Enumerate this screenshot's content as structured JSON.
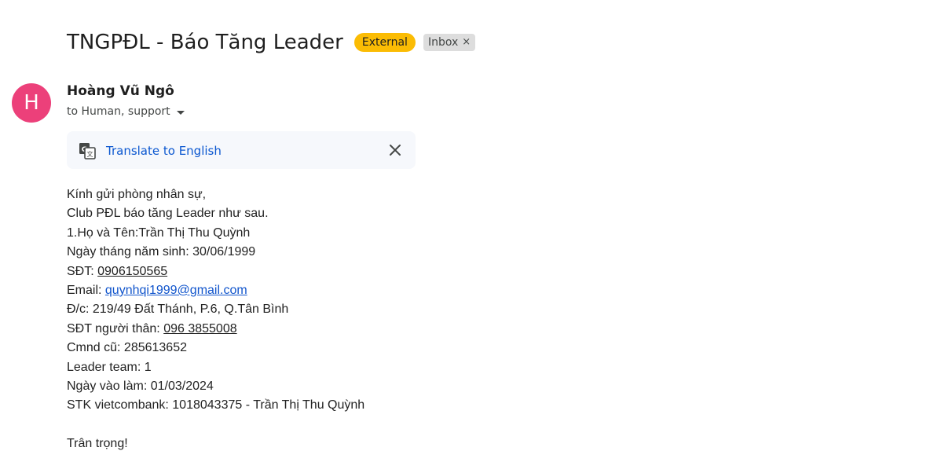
{
  "email": {
    "subject": "TNGPĐL - Báo Tăng Leader",
    "badges": {
      "external": "External",
      "inbox": "Inbox",
      "inbox_remove_glyph": "×"
    },
    "sender": {
      "avatar_letter": "H",
      "avatar_color": "#ec407a",
      "name": "Hoàng Vũ Ngô",
      "recipients": "to Human, support"
    },
    "translate": {
      "label": "Translate to English",
      "icon": "translate-icon",
      "close_icon": "close-icon"
    },
    "body": {
      "greeting": "Kính gửi phòng nhân sự,",
      "intro": "Club PĐL báo tăng Leader như sau.",
      "name_line": "1.Họ và Tên:Trần Thị Thu Quỳnh",
      "dob_line": "Ngày tháng năm sinh: 30/06/1999",
      "phone_label": "SĐT: ",
      "phone_value": "0906150565",
      "email_label": "Email: ",
      "email_value": "quynhqi1999@gmail.com",
      "address_line": "Đ/c: 219/49 Đất Thánh, P.6, Q.Tân Bình",
      "relative_phone_label": "SĐT người thân: ",
      "relative_phone_value": "096 3855008",
      "id_line": "Cmnd cũ: 285613652",
      "team_line": "Leader team: 1",
      "start_date_line": "Ngày vào làm: 01/03/2024",
      "bank_line": "STK vietcombank: 1018043375 - Trần Thị Thu Quỳnh",
      "closing": "Trân trọng!"
    }
  },
  "colors": {
    "external_badge": "#fbbc04",
    "inbox_badge": "#dddddd",
    "link_blue": "#0b57d0",
    "email_link": "#1155cc",
    "translate_bar_bg": "#f6f8fc"
  }
}
